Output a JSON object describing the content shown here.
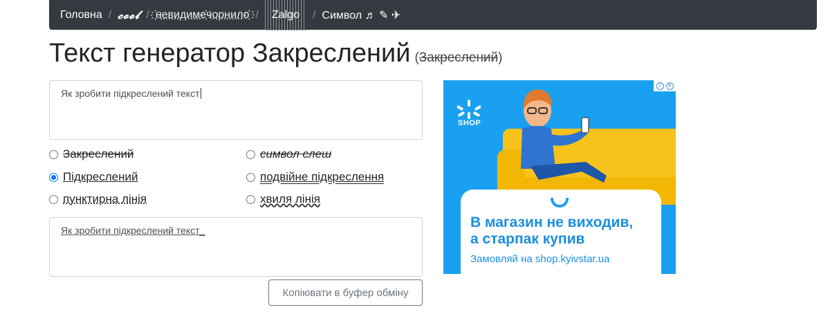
{
  "nav": {
    "items": [
      {
        "label": "Головна",
        "style": "plain"
      },
      {
        "label": "𝓬𝓸𝓸𝓵",
        "style": "cool"
      },
      {
        "label": "҉невидиме҉чорнило҉",
        "style": "ink"
      },
      {
        "label": "Zalgo",
        "style": "zalgo"
      },
      {
        "label": "Символ ♬ ✎ ✈",
        "style": "plain"
      }
    ],
    "separator": "/"
  },
  "heading": {
    "title": "Текст генератор Закреслений",
    "subtitle_open": "(",
    "subtitle_text": "Закреслений",
    "subtitle_close": ")"
  },
  "input": {
    "value": "Як зробити підкреслений текст"
  },
  "options": {
    "left": [
      {
        "label": "Закреслений",
        "style": "strike",
        "selected": false
      },
      {
        "label": "Підкреслений",
        "style": "under",
        "selected": true
      },
      {
        "label": "пунктирна лінія",
        "style": "dotted",
        "selected": false
      }
    ],
    "right": [
      {
        "label": "символ слеш",
        "style": "slash",
        "selected": false
      },
      {
        "label": "подвійне підкреслення",
        "style": "double",
        "selected": false
      },
      {
        "label": "хвиля лінія",
        "style": "wave",
        "selected": false
      }
    ]
  },
  "output": {
    "value": "Як зробити підкреслений текст_"
  },
  "copy_button": {
    "label": "Копіювати в буфер обміну"
  },
  "ad": {
    "brand": "SHOP",
    "headline_line1": "В магазин не виходив,",
    "headline_line2": "а старпак купив",
    "subline": "Замовляй на shop.kyivstar.ua",
    "colors": {
      "background": "#1aa0f0",
      "sofa": "#f6c21b",
      "text": "#1a8fe0"
    }
  },
  "colors": {
    "navbar": "#343a40",
    "radio_selected": "#0075ff",
    "button_border": "#6c757d"
  }
}
